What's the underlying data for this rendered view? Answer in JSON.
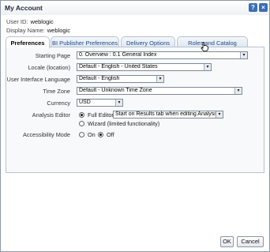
{
  "window": {
    "title": "My Account",
    "help_glyph": "?",
    "close_glyph": "×"
  },
  "user": {
    "id_label": "User ID:",
    "id_value": "weblogic",
    "display_label": "Display Name:",
    "display_value": "weblogic"
  },
  "tabs": [
    {
      "label": "Preferences",
      "active": true
    },
    {
      "label": "BI Publisher Preferences",
      "active": false
    },
    {
      "label": "Delivery Options",
      "active": false
    },
    {
      "label": "Roles and Catalog Groups",
      "active": false
    }
  ],
  "form": {
    "starting_page": {
      "label": "Starting Page",
      "value": "0. Overview : 0.1 General Index"
    },
    "locale": {
      "label": "Locale (location)",
      "value": "Default - English - United States"
    },
    "ui_language": {
      "label": "User Interface Language",
      "value": "Default - English"
    },
    "time_zone": {
      "label": "Time Zone",
      "value": "Default - Unknown Time Zone"
    },
    "currency": {
      "label": "Currency",
      "value": "USD"
    },
    "analysis_editor": {
      "label": "Analysis Editor",
      "full_editor_label": "Full Editor",
      "full_editor_select": "Start on Results tab when editing Analysis",
      "wizard_label": "Wizard (limited functionality)",
      "selected": "Full Editor"
    },
    "accessibility": {
      "label": "Accessibility Mode",
      "on_label": "On",
      "off_label": "Off",
      "selected": "Off"
    }
  },
  "buttons": {
    "ok": "OK",
    "cancel": "Cancel"
  },
  "icons": {
    "dropdown": "▾",
    "cursor": "hand-pointer"
  }
}
